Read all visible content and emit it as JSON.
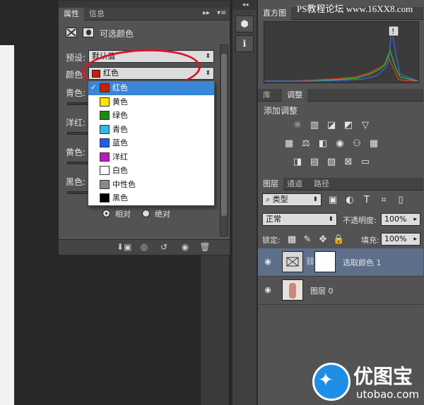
{
  "watermark": "PS教程论坛 www.16XX8.com",
  "properties": {
    "tabs": [
      "属性",
      "信息"
    ],
    "title": "可选颜色",
    "preset_label": "预设:",
    "preset_value": "默认值",
    "colors_label": "颜色:",
    "colors_value": "红色",
    "colors_swatch": "#cc1f00",
    "sliders": [
      "青色:",
      "洋红:",
      "黄色:",
      "黑色:"
    ],
    "method": {
      "relative": "相对",
      "absolute": "绝对",
      "selected": "relative"
    }
  },
  "dropdown": {
    "selected": "红色",
    "items": [
      {
        "label": "红色",
        "color": "#cc1f00"
      },
      {
        "label": "黄色",
        "color": "#ffe400"
      },
      {
        "label": "绿色",
        "color": "#1a8a12"
      },
      {
        "label": "青色",
        "color": "#2fb9e8"
      },
      {
        "label": "蓝色",
        "color": "#1f5ef0"
      },
      {
        "label": "洋红",
        "color": "#c115c4"
      },
      {
        "label": "白色",
        "color": "#ffffff"
      },
      {
        "label": "中性色",
        "color": "#8a8a8a"
      },
      {
        "label": "黑色",
        "color": "#000000"
      }
    ]
  },
  "right": {
    "histogram_tab": "直方图",
    "adjust_tabs": [
      "库",
      "调整"
    ],
    "adjust_title": "添加调整",
    "layer_tabs": [
      "图层",
      "通道",
      "路径"
    ],
    "filter_type": "类型",
    "blend_mode": "正常",
    "opacity_label": "不透明度:",
    "opacity_value": "100%",
    "lock_label": "锁定:",
    "fill_label": "填充:",
    "fill_value": "100%",
    "layers": [
      {
        "name": "选取颜色 1"
      },
      {
        "name": "图层 0"
      }
    ]
  },
  "logo": {
    "text": "优图宝",
    "url": "utobao.com"
  }
}
